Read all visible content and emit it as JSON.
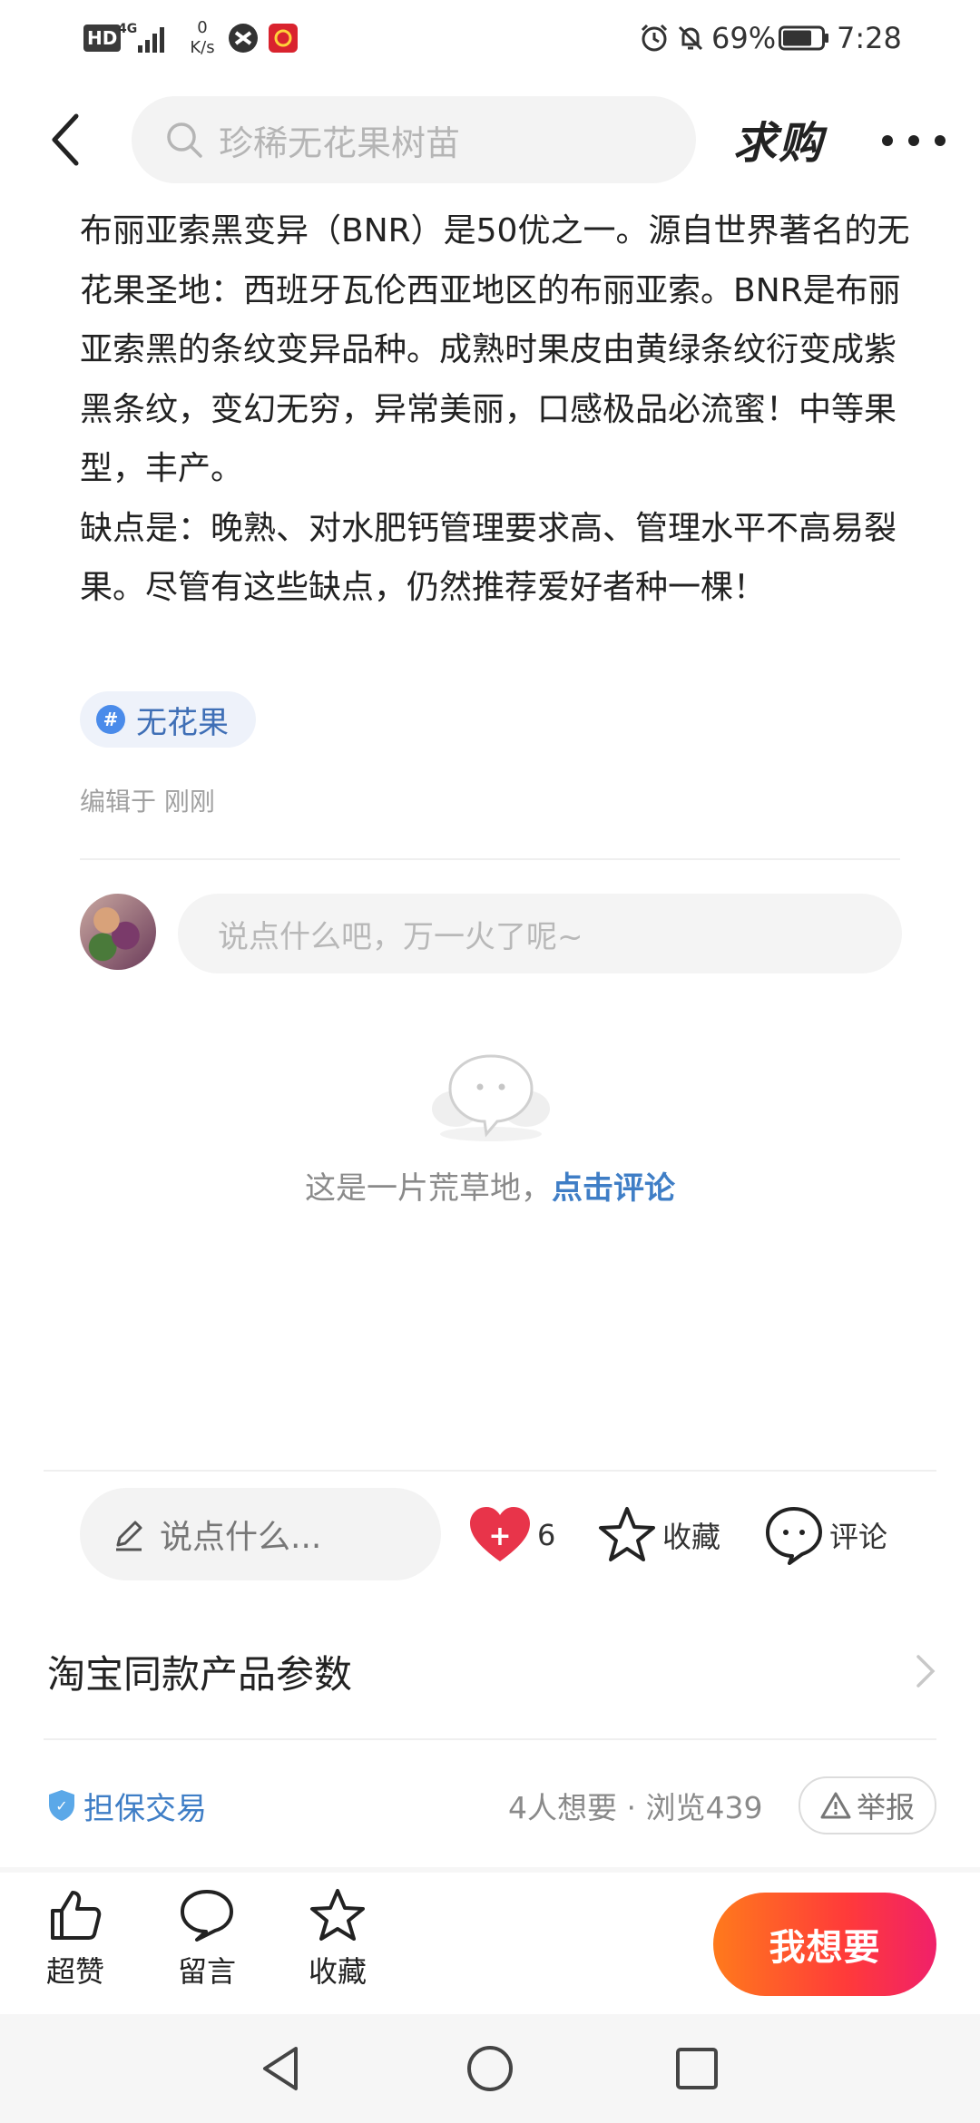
{
  "status_bar": {
    "hd": "HD",
    "network": "4G",
    "net_speed_value": "0",
    "net_speed_unit": "K/s",
    "battery_percent": "69%",
    "time": "7:28"
  },
  "top_nav": {
    "search_placeholder": "珍稀无花果树苗",
    "title": "求购"
  },
  "post": {
    "paragraph_1": "布丽亚索黑变异（BNR）是50优之一。源自世界著名的无花果圣地：西班牙瓦伦西亚地区的布丽亚索。BNR是布丽亚索黑的条纹变异品种。成熟时果皮由黄绿条纹衍变成紫黑条纹，变幻无穷，异常美丽，口感极品必流蜜！中等果型，丰产。",
    "paragraph_2": "缺点是：晚熟、对水肥钙管理要求高、管理水平不高易裂果。尽管有这些缺点，仍然推荐爱好者种一棵！",
    "tag_symbol": "#",
    "tag": "无花果",
    "edited": "编辑于 刚刚"
  },
  "comments": {
    "input_placeholder": "说点什么吧，万一火了呢~",
    "empty_text": "这是一片荒草地，",
    "empty_link": "点击评论"
  },
  "action_bar": {
    "say_placeholder": "说点什么...",
    "want_label": "6",
    "fav_label": "收藏",
    "comment_label": "评论"
  },
  "taobao": {
    "title": "淘宝同款产品参数"
  },
  "guarantee": {
    "label": "担保交易",
    "stats": "4人想要 · 浏览439",
    "report": "举报"
  },
  "bottom_bar": {
    "like": "超赞",
    "message": "留言",
    "favorite": "收藏",
    "want_button": "我想要"
  },
  "colors": {
    "link_blue": "#3f7ec6",
    "want_gradient_start": "#ff7a1c",
    "want_gradient_end": "#f0206a",
    "heart_red": "#e8344a"
  }
}
